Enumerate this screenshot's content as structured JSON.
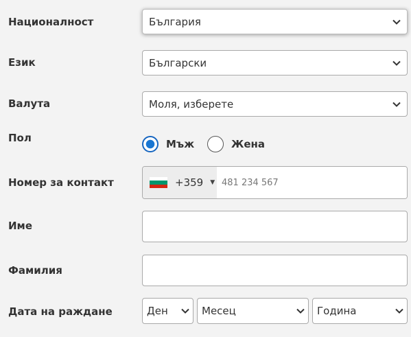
{
  "form": {
    "nationality": {
      "label": "Националност",
      "value": "България"
    },
    "language": {
      "label": "Език",
      "value": "Български"
    },
    "currency": {
      "label": "Валута",
      "value": "Моля, изберете"
    },
    "gender": {
      "label": "Пол",
      "options": [
        "Мъж",
        "Жена"
      ],
      "selected": "Мъж"
    },
    "contact": {
      "label": "Номер за контакт",
      "country_code": "+359",
      "flag_icon": "bulgaria-flag-icon",
      "flag_colors": [
        "#ffffff",
        "#00966e",
        "#d62612"
      ],
      "placeholder": "481 234 567",
      "value": ""
    },
    "first_name": {
      "label": "Име",
      "value": ""
    },
    "last_name": {
      "label": "Фамилия",
      "value": ""
    },
    "birth_date": {
      "label": "Дата на раждане",
      "day": "Ден",
      "month": "Месец",
      "year": "Година"
    }
  },
  "colors": {
    "background": "#f3f3f3",
    "radio_accent": "#1976d2",
    "border": "#a9a9a9"
  }
}
